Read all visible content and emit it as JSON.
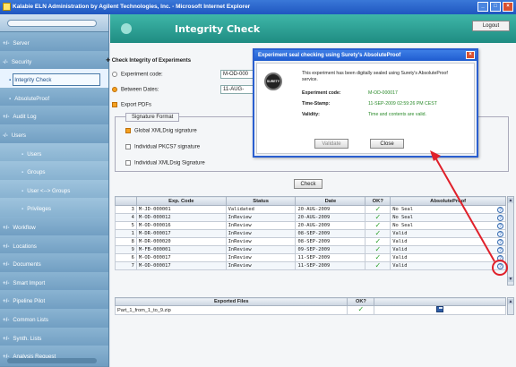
{
  "window": {
    "title": "Kalabie ELN Administration by Agilent Technologies, Inc. - Microsoft Internet Explorer"
  },
  "header": {
    "title": "Integrity Check",
    "logout_label": "Logout"
  },
  "sidebar": {
    "items": [
      {
        "label": "Server",
        "prefix": "+",
        "level": 0
      },
      {
        "label": "Security",
        "prefix": "-",
        "level": 0
      },
      {
        "label": "Integrity Check",
        "level": 1,
        "active": true
      },
      {
        "label": "AbsoluteProof",
        "level": 1
      },
      {
        "label": "Audit Log",
        "prefix": "+",
        "level": 0
      },
      {
        "label": "Users",
        "prefix": "-",
        "level": 0
      },
      {
        "label": "Users",
        "level": 2
      },
      {
        "label": "Groups",
        "level": 2
      },
      {
        "label": "User <--> Groups",
        "level": 2
      },
      {
        "label": "Privileges",
        "level": 2
      },
      {
        "label": "Workflow",
        "prefix": "+",
        "level": 0
      },
      {
        "label": "Locations",
        "prefix": "+",
        "level": 0
      },
      {
        "label": "Documents",
        "prefix": "+",
        "level": 0
      },
      {
        "label": "Smart Import",
        "prefix": "+",
        "level": 0
      },
      {
        "label": "Pipeline Pilot",
        "prefix": "+",
        "level": 0
      },
      {
        "label": "Common Lists",
        "prefix": "+",
        "level": 0
      },
      {
        "label": "Synth. Lists",
        "prefix": "+",
        "level": 0
      },
      {
        "label": "Analysis Request",
        "prefix": "+",
        "level": 0
      }
    ]
  },
  "form": {
    "section_title": "Check Integrity of Experiments",
    "experiment_code_label": "Experiment code:",
    "experiment_code_value": "M-OD-000",
    "between_dates_label": "Between Dates:",
    "date_from_value": "11-AUG-",
    "export_pdfs_label": "Export PDFs",
    "signature_format_legend": "Signature Format",
    "opt_global_xmldsig": "Global XMLDsig signature",
    "opt_individual_pkcs7": "Individual PKCS7 signature",
    "opt_individual_xmldsig": "Individual XMLDsig Signature",
    "check_button": "Check"
  },
  "results": {
    "columns": [
      "",
      "Exp. Code",
      "Status",
      "Date",
      "OK?",
      "AbsoluteProof"
    ],
    "rows": [
      {
        "n": "3",
        "code": "M-JD-000001",
        "status": "Validated",
        "date": "20-AUG-2009",
        "proof": "No Seal"
      },
      {
        "n": "4",
        "code": "M-OD-000012",
        "status": "InReview",
        "date": "20-AUG-2009",
        "proof": "No Seal"
      },
      {
        "n": "5",
        "code": "M-OD-000016",
        "status": "InReview",
        "date": "20-AUG-2009",
        "proof": "No Seal"
      },
      {
        "n": "1",
        "code": "M-DR-000017",
        "status": "InReview",
        "date": "08-SEP-2009",
        "proof": "Valid"
      },
      {
        "n": "8",
        "code": "M-DR-000020",
        "status": "InReview",
        "date": "08-SEP-2009",
        "proof": "Valid"
      },
      {
        "n": "9",
        "code": "M-FB-000001",
        "status": "InReview",
        "date": "09-SEP-2009",
        "proof": "Valid"
      },
      {
        "n": "6",
        "code": "M-OD-000017",
        "status": "InReview",
        "date": "11-SEP-2009",
        "proof": "Valid"
      },
      {
        "n": "7",
        "code": "M-OD-000017",
        "status": "InReview",
        "date": "11-SEP-2009",
        "proof": "Valid"
      }
    ]
  },
  "exported": {
    "columns": [
      "Exported Files",
      "OK?",
      ""
    ],
    "rows": [
      {
        "file": "Part_1_from_1_to_9.zip"
      }
    ]
  },
  "dialog": {
    "title": "Experiment seal checking using Surety's AbsoluteProof",
    "message": "This experiment has been digitally sealed using Surety's AbsoluteProof service.",
    "seal_label": "SURETY",
    "code_label": "Experiment code:",
    "code_value": "M-OD-000017",
    "timestamp_label": "Time-Stamp:",
    "timestamp_value": "11-SEP-2009 02:59:26 PM CEST",
    "validity_label": "Validity:",
    "validity_value": "Time and contents are valid.",
    "validate_button": "Validate",
    "close_button": "Close"
  },
  "colors": {
    "accent": "#1f8c82",
    "sidebar": "#7ba8c8",
    "annotation": "#e0202a",
    "ok": "#2aa02a"
  }
}
